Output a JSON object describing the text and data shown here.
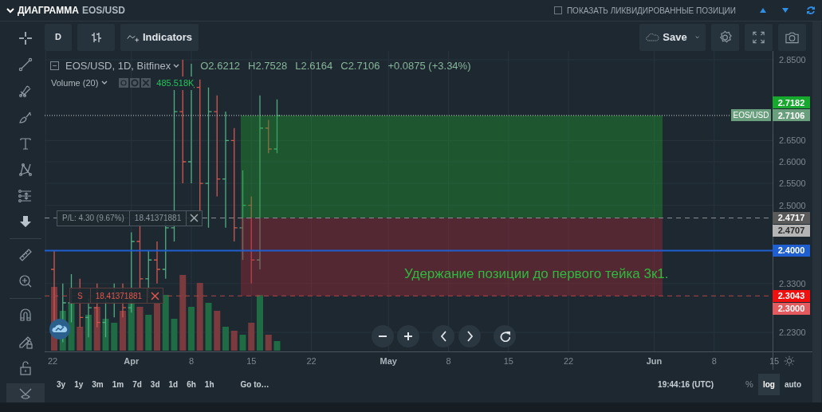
{
  "header": {
    "title": "ДИАГРАММА",
    "symbol": "EOS/USD",
    "checkbox": {
      "label": "ПОКАЗАТЬ ЛИКВИДИРОВАННЫЕ ПОЗИЦИИ",
      "checked": false
    }
  },
  "toolbar": {
    "interval": "D",
    "indicators": "Indicators",
    "save": "Save"
  },
  "legend": {
    "title": "EOS/USD, 1D, Bitfinex",
    "values": [
      "O2.6212",
      "H2.7528",
      "L2.6164",
      "C2.7106"
    ],
    "change": "+0.0875 (+3.34%)",
    "volume_title": "Volume (20)",
    "volume_value": "485.518K"
  },
  "price_ticks": [
    "2.8500",
    "2.6500",
    "2.6000",
    "2.5500",
    "2.5000",
    "2.3300",
    "2.2300"
  ],
  "price_tags": [
    {
      "kind": "mark",
      "text": "2.7182",
      "color": "#16a92e"
    },
    {
      "kind": "last",
      "label": "EOS/USD",
      "text": "2.7106",
      "color": "#6a9f7e"
    },
    {
      "kind": "entry",
      "text": "2.4717",
      "color": "#5a5a5a"
    },
    {
      "kind": "mark",
      "text": "2.4707",
      "color": "#b4b4b4"
    },
    {
      "kind": "alert",
      "text": "2.4000",
      "color": "#1f5fcf"
    },
    {
      "kind": "stop",
      "text": "2.3043",
      "color": "#f01010"
    },
    {
      "kind": "mark",
      "text": "2.3000",
      "color": "#e35a5f"
    }
  ],
  "time_ticks": [
    {
      "text": "22",
      "kind": "day"
    },
    {
      "text": "Apr",
      "kind": "month"
    },
    {
      "text": "8",
      "kind": "day"
    },
    {
      "text": "15",
      "kind": "day"
    },
    {
      "text": "22",
      "kind": "day"
    },
    {
      "text": "May",
      "kind": "month"
    },
    {
      "text": "8",
      "kind": "day"
    },
    {
      "text": "15",
      "kind": "day"
    },
    {
      "text": "22",
      "kind": "day"
    },
    {
      "text": "Jun",
      "kind": "month"
    },
    {
      "text": "8",
      "kind": "day"
    },
    {
      "text": "15",
      "kind": "day"
    }
  ],
  "orders": [
    {
      "kind": "profit",
      "label": "P/L: 4.30 (9.67%)",
      "quantity": "18.41371881"
    },
    {
      "kind": "stop",
      "label": "S",
      "quantity": "18.41371881"
    }
  ],
  "note": "Удержание позиции до первого тейка 3к1.",
  "ranges": [
    "3y",
    "1y",
    "3m",
    "1m",
    "7d",
    "3d",
    "1d",
    "6h",
    "1h"
  ],
  "goto": "Go to…",
  "clock": "19:44:16 (UTC)",
  "scale_options": [
    {
      "label": "%",
      "selected": false
    },
    {
      "label": "log",
      "selected": true
    },
    {
      "label": "auto",
      "selected": false
    }
  ]
}
